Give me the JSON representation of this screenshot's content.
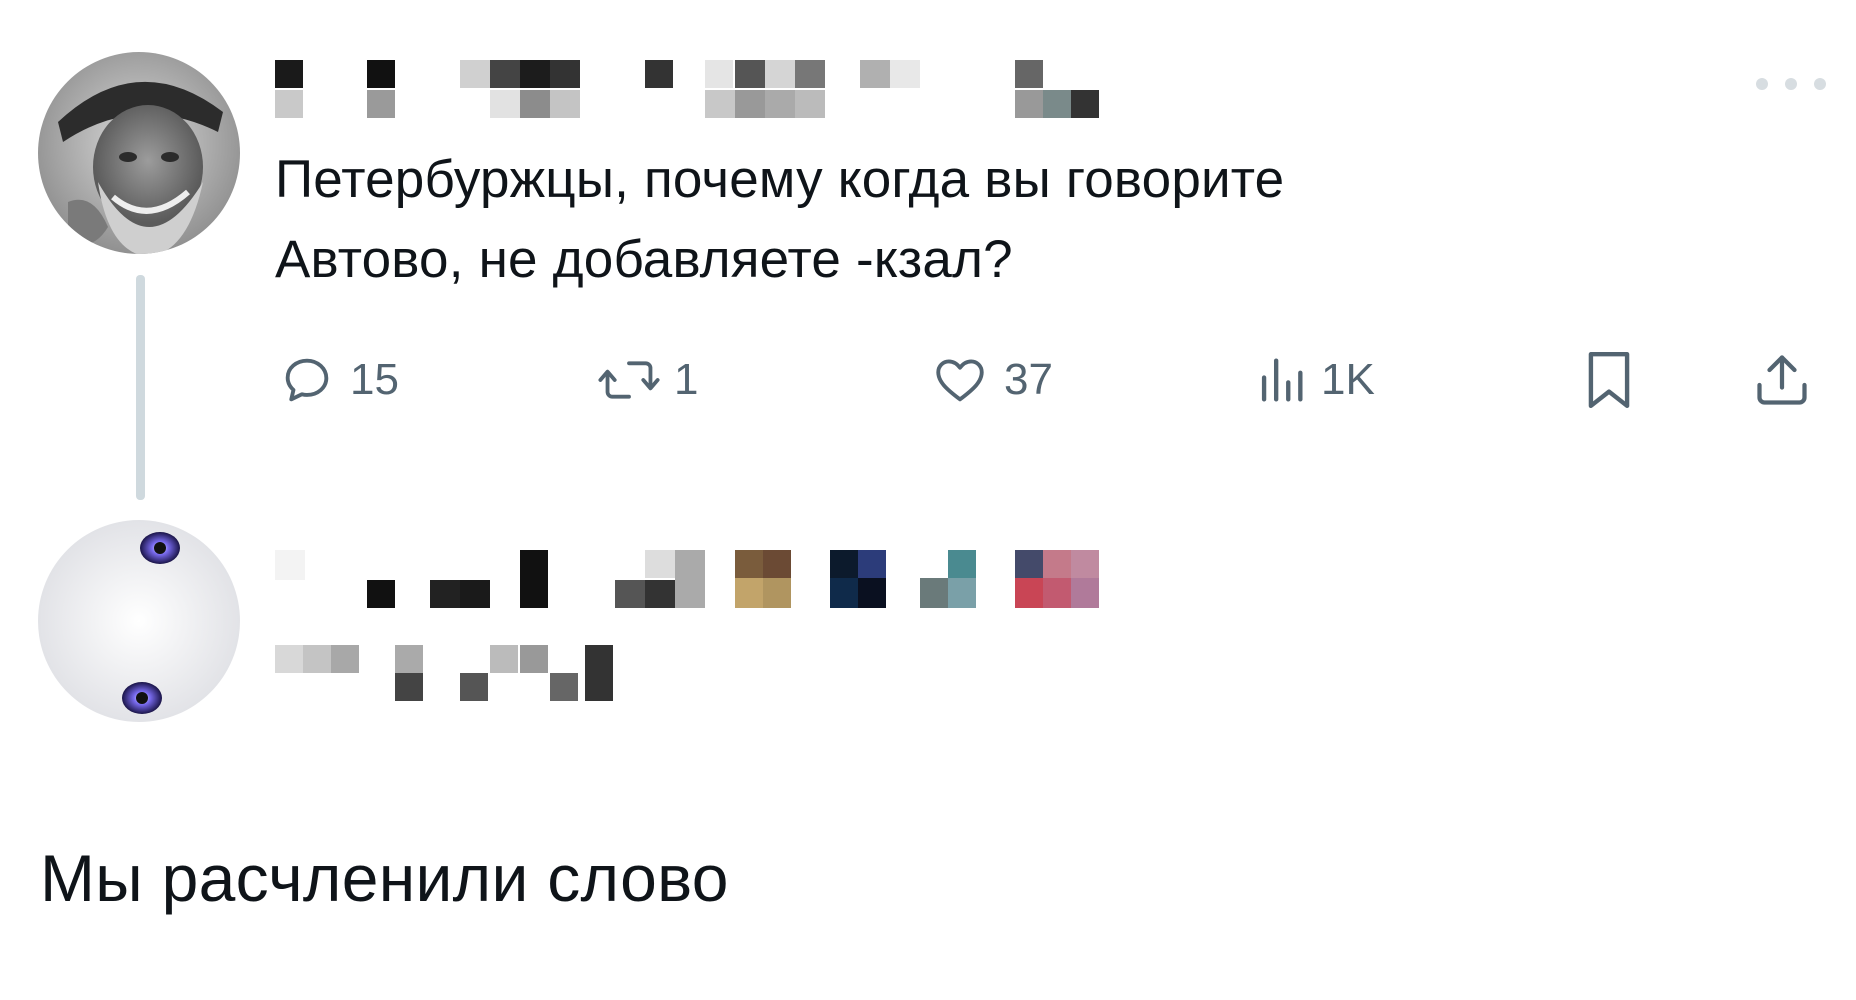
{
  "tweet": {
    "text_line_1": "Петербуржцы, почему когда вы говорите",
    "text_line_2": "Автово, не добавляете -кзал?",
    "actions": {
      "replies": "15",
      "retweets": "1",
      "likes": "37",
      "views": "1K"
    },
    "author_name": "",
    "author_handle": ""
  },
  "reply": {
    "author_name": "",
    "author_handle": ""
  },
  "caption": "Мы расчленили слово",
  "icons": [
    "more-icon",
    "reply-icon",
    "retweet-icon",
    "like-icon",
    "views-icon",
    "bookmark-icon",
    "share-icon"
  ],
  "colors": {
    "text": "#0f1419",
    "secondary": "#536471",
    "thread_line": "#cfd9de",
    "background": "#ffffff"
  }
}
